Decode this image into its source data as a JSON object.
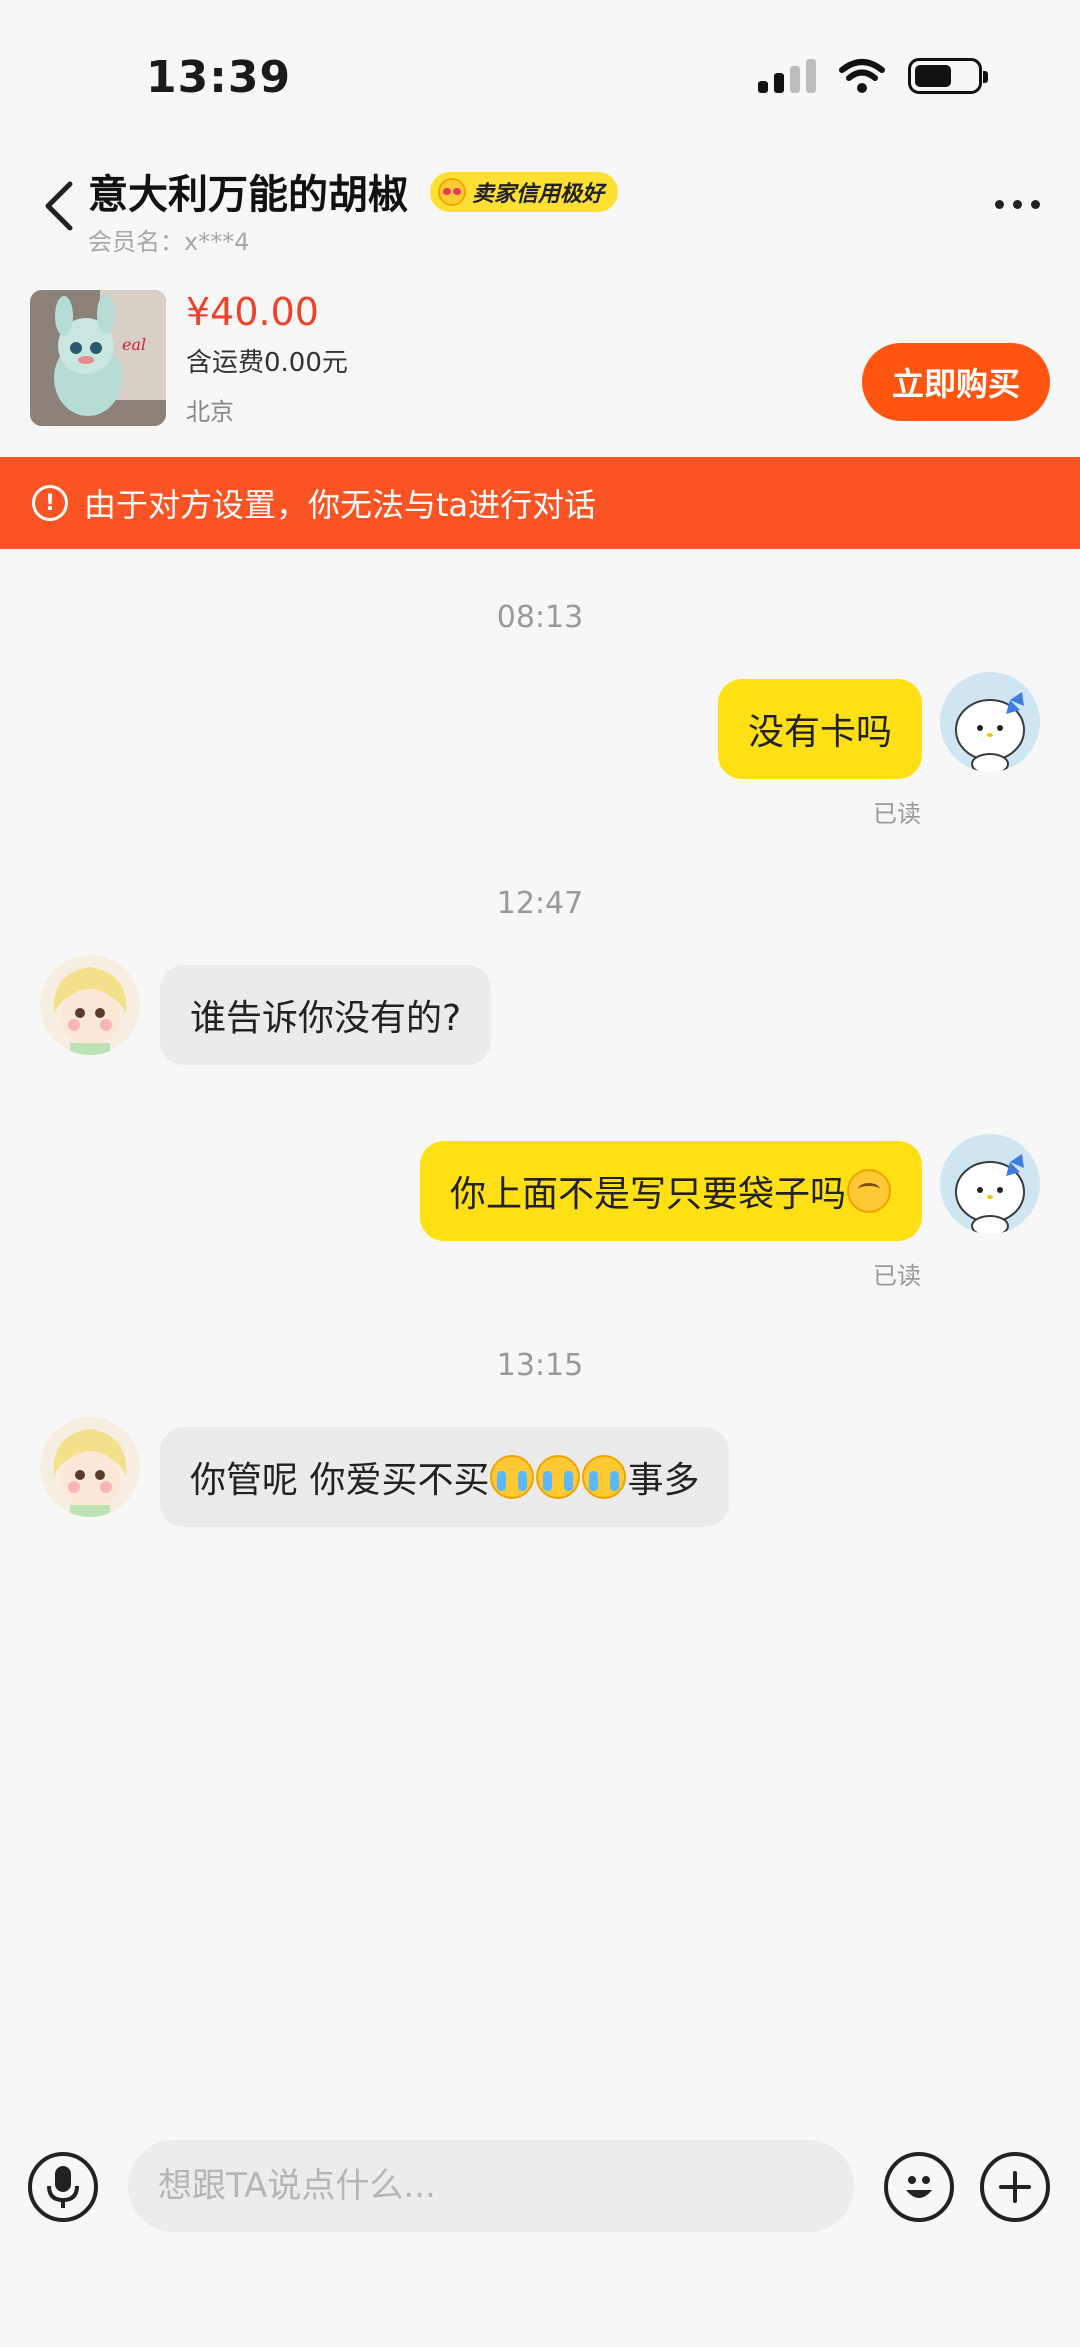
{
  "status_bar": {
    "time": "13:39"
  },
  "header": {
    "title": "意大利万能的胡椒",
    "credit_badge": "卖家信用极好",
    "member_label": "会员名：x***4"
  },
  "product": {
    "price": "¥40.00",
    "shipping": "含运费0.00元",
    "location": "北京",
    "buy_label": "立即购买"
  },
  "warning": {
    "text": "由于对方设置，你无法与ta进行对话"
  },
  "chat": {
    "times": [
      "08:13",
      "12:47",
      "13:15"
    ],
    "msg1": "没有卡吗",
    "msg2": "谁告诉你没有的?",
    "msg3": "你上面不是写只要袋子吗",
    "msg4_a": "你管呢 你爱买不买",
    "msg4_b": "事多",
    "read_label": "已读"
  },
  "input": {
    "placeholder": "想跟TA说点什么..."
  },
  "colors": {
    "accent": "#ff5511",
    "banner": "#fa5424",
    "bubble_mine": "#ffe014",
    "price": "#f0412b"
  },
  "icons": [
    "back-icon",
    "more-icon",
    "alert-icon",
    "mic-icon",
    "emoji-icon",
    "plus-icon"
  ]
}
